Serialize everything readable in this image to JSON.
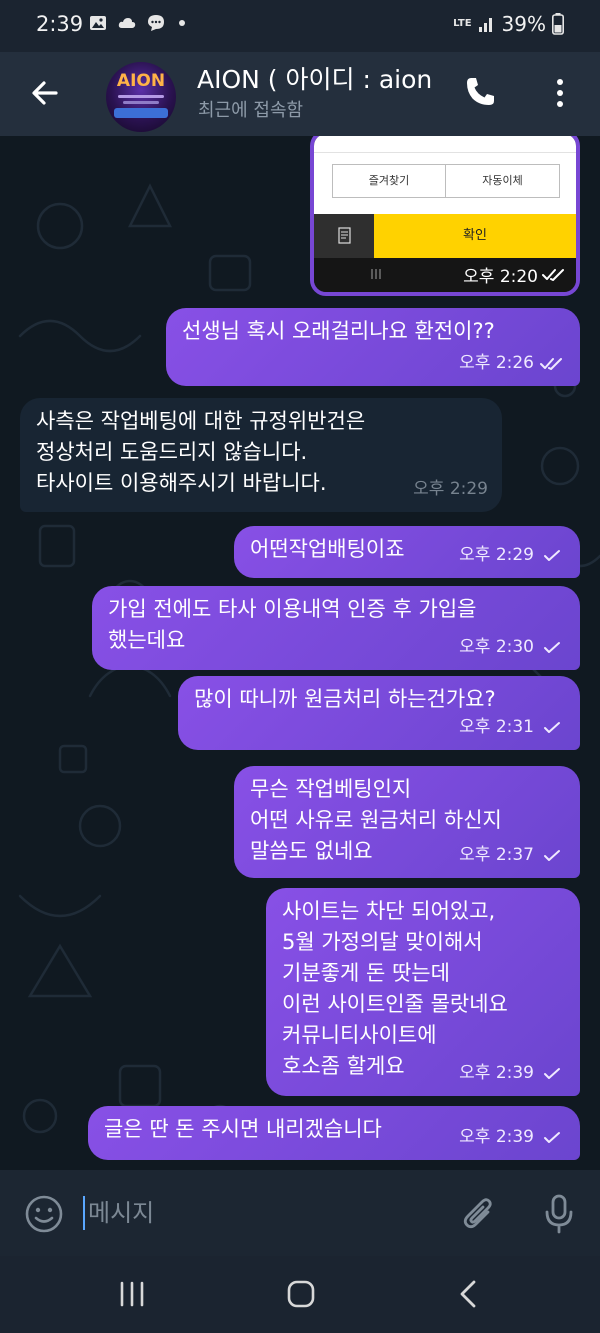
{
  "status_bar": {
    "time": "2:39",
    "network": "LTE",
    "battery": "39%"
  },
  "header": {
    "title": "AION ( 아이디 : aion",
    "status": "최근에 접속함",
    "avatar_logo": "AION"
  },
  "image_message": {
    "button_left": "즐겨찾기",
    "button_right": "자동이체",
    "confirm": "확인",
    "time": "오후 2:20"
  },
  "messages": [
    {
      "direction": "out",
      "text": "선생님 혹시 오래걸리나요 환전이??",
      "time": "오후 2:26",
      "status": "read"
    },
    {
      "direction": "in",
      "text": "사측은 작업베팅에 대한 규정위반건은\n정상처리 도움드리지 않습니다.\n타사이트 이용해주시기 바랍니다.",
      "time": "오후 2:29"
    },
    {
      "direction": "out",
      "text": "어떤작업배팅이죠",
      "time": "오후 2:29",
      "status": "sent"
    },
    {
      "direction": "out",
      "text": "가입 전에도 타사 이용내역 인증 후 가입을\n했는데요",
      "time": "오후 2:30",
      "status": "sent"
    },
    {
      "direction": "out",
      "text": "많이 따니까 원금처리 하는건가요?",
      "time": "오후 2:31",
      "status": "sent"
    },
    {
      "direction": "out",
      "text": "무슨 작업베팅인지\n어떤 사유로 원금처리 하신지\n말씀도 없네요",
      "time": "오후 2:37",
      "status": "sent"
    },
    {
      "direction": "out",
      "text": "사이트는 차단 되어있고,\n5월 가정의달 맞이해서\n기분좋게 돈 땃는데\n이런 사이트인줄 몰랏네요\n커뮤니티사이트에\n호소좀 할게요",
      "time": "오후 2:39",
      "status": "sent"
    },
    {
      "direction": "out",
      "text": "글은 딴 돈 주시면 내리겠습니다",
      "time": "오후 2:39",
      "status": "sent"
    }
  ],
  "input": {
    "placeholder": "메시지"
  },
  "colors": {
    "outgoing_bubble": "#7a4ad9",
    "incoming_bubble": "#182533",
    "header_bg": "#242f3d",
    "chat_bg": "#101921"
  },
  "icons": {
    "back": "arrow-left-icon",
    "call": "phone-icon",
    "menu": "more-vertical-icon",
    "emoji": "smile-icon",
    "attach": "paperclip-icon",
    "mic": "microphone-icon"
  }
}
